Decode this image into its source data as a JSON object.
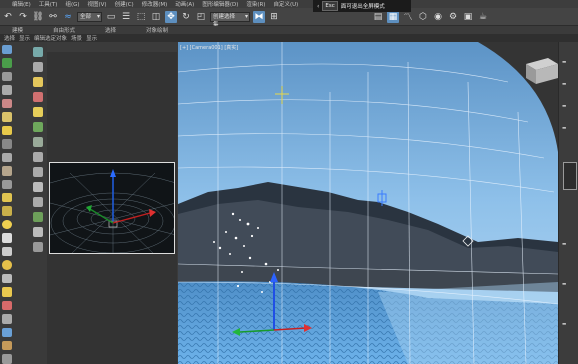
{
  "menu": {
    "items": [
      "编辑(E)",
      "工具(T)",
      "组(G)",
      "视图(V)",
      "创建(C)",
      "修改器(M)",
      "动画(A)",
      "图形编辑器(D)",
      "渲染(R)",
      "自定义(U)"
    ]
  },
  "fullscreen_hint": {
    "key": "Esc",
    "text": "面可退出全屏模式"
  },
  "toolbar": {
    "selection_filter": "全部",
    "selection_set": "创建选择集"
  },
  "tabs": {
    "row1": [
      "建模",
      "自由形式",
      "选择",
      "对象绘制"
    ],
    "row2": [
      "选择",
      "显示",
      "编辑选定对象",
      "场景",
      "显示"
    ]
  },
  "scene_panel": {
    "header": ""
  },
  "viewport": {
    "label": "[+] [Camera001] [真实]"
  },
  "colors": {
    "accent": "#5d8fbf",
    "sky_top": "#7fb6e6",
    "water": "#6fb0e6",
    "grid": "#e8f3ff"
  }
}
